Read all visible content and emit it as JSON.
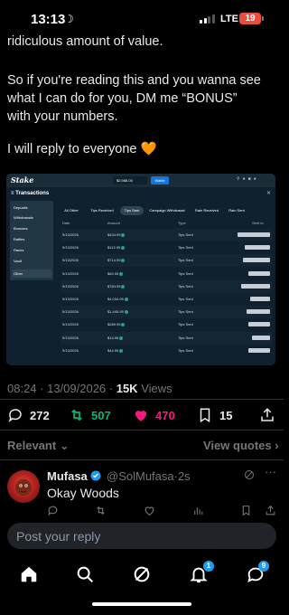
{
  "status": {
    "time": "13:13",
    "network": "LTE",
    "battery": "19"
  },
  "tweet": {
    "line0": "ridiculous amount of value.",
    "line1": "So if you're reading this and you wanna see",
    "line2": "what I can do for you, DM me “BONUS”",
    "line3": "with your numbers.",
    "line4": "I will reply to everyone",
    "line4_emoji": "🧡"
  },
  "embed": {
    "logo": "Stake",
    "balance": "$2,985.00",
    "wallet_label": "Wallet",
    "title": "Transactions",
    "sidebar": [
      "Deposits",
      "Withdrawals",
      "Bonuses",
      "Raffles",
      "Races",
      "Vault",
      "Other"
    ],
    "tabs": [
      "All Other",
      "Tips Received",
      "Tips Sent",
      "Campaign Withdrawal",
      "Rain Received",
      "Rain Sent"
    ],
    "active_tab": "Tips Sent",
    "columns": [
      "Date",
      "Amount",
      "Type",
      "Sent to"
    ],
    "rows": [
      {
        "date": "9/13/2026",
        "amount": "$424.99",
        "type": "Tips Sent"
      },
      {
        "date": "9/13/2026",
        "amount": "$113.95",
        "type": "Tips Sent"
      },
      {
        "date": "9/13/2026",
        "amount": "$714.99",
        "type": "Tips Sent"
      },
      {
        "date": "9/13/2026",
        "amount": "$84.95",
        "type": "Tips Sent"
      },
      {
        "date": "9/13/2026",
        "amount": "$784.95",
        "type": "Tips Sent"
      },
      {
        "date": "9/13/2026",
        "amount": "$4,034.95",
        "type": "Tips Sent"
      },
      {
        "date": "9/13/2026",
        "amount": "$1,445.95",
        "type": "Tips Sent"
      },
      {
        "date": "9/13/2026",
        "amount": "$289.95",
        "type": "Tips Sent"
      },
      {
        "date": "9/13/2026",
        "amount": "$14.95",
        "type": "Tips Sent"
      },
      {
        "date": "9/13/2026",
        "amount": "$44.95",
        "type": "Tips Sent"
      }
    ]
  },
  "meta": {
    "time": "08:24 · 13/09/2026 ·",
    "views_count": "15K",
    "views_label": "Views"
  },
  "actions": {
    "replies": "272",
    "reposts": "507",
    "likes": "470",
    "bookmarks": "15"
  },
  "sort": {
    "relevant": "Relevant",
    "view_quotes": "View quotes"
  },
  "reply": {
    "name": "Mufasa",
    "handle": "@SolMufasa",
    "time": "·2s",
    "text": "Okay Woods",
    "more": "···"
  },
  "compose": {
    "placeholder": "Post your reply"
  },
  "nav": {
    "notifications_badge": "1",
    "messages_badge": "9"
  },
  "colors": {
    "repost": "#00ba7c",
    "like": "#f91880",
    "accent": "#1d9bf0",
    "stake_bg": "#0f212e"
  }
}
